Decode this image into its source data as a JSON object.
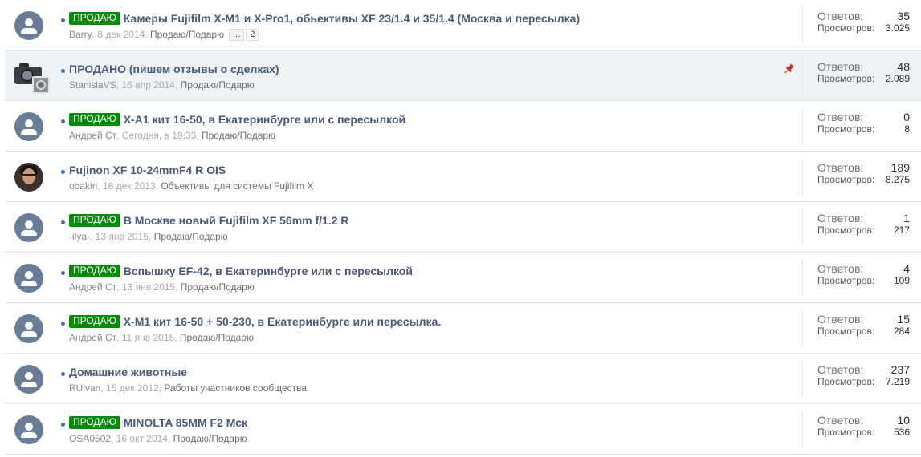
{
  "stats_labels": {
    "replies": "Ответов:",
    "views": "Просмотров:"
  },
  "colors": {
    "prefix_bg": "#0a8a0a",
    "title": "#4a5a7a",
    "avatar_default": "#6a7d96",
    "sticky_row": "#f0f3f6",
    "pin": "#c9302c"
  },
  "threads": [
    {
      "avatar": "default-avatar",
      "prefix": "ПРОДАЮ",
      "title": "Камеры Fujifilm X-M1 и X-Pro1, обьективы XF 23/1.4 и 35/1.4 (Москва и пересылка)",
      "author": "Barry",
      "date": "8 дек 2014",
      "forum": "Продаю/Подарю",
      "pages": [
        "...",
        "2"
      ],
      "replies": "35",
      "views": "3.025"
    },
    {
      "avatar": "camera-avatar",
      "sticky": true,
      "prefix": "",
      "title": "ПРОДАНО (пишем отзывы о сделках)",
      "author": "StanislaVS",
      "date": "16 апр 2014",
      "forum": "Продаю/Подарю",
      "replies": "48",
      "views": "2.089"
    },
    {
      "avatar": "default-avatar",
      "prefix": "ПРОДАЮ",
      "title": "X-A1 кит 16-50, в Екатеринбурге или с пересылкой",
      "author": "Андрей Ст",
      "date": "Сегодня, в 19:33",
      "forum": "Продаю/Подарю",
      "replies": "0",
      "views": "8"
    },
    {
      "avatar": "person-avatar",
      "prefix": "",
      "title": "Fujinon XF 10-24mmF4 R OIS",
      "author": "obakiri",
      "date": "18 дек 2013",
      "forum": "Объективы для системы Fujifilm X",
      "replies": "189",
      "views": "8.275"
    },
    {
      "avatar": "default-avatar",
      "prefix": "ПРОДАЮ",
      "title": "В Москве новый Fujifilm XF 56mm f/1.2 R",
      "author": "-ilya-",
      "date": "13 янв 2015",
      "forum": "Продаю/Подарю",
      "replies": "1",
      "views": "217"
    },
    {
      "avatar": "default-avatar",
      "prefix": "ПРОДАЮ",
      "title": "Вспышку EF-42, в Екатеринбурге или с пересылкой",
      "author": "Андрей Ст",
      "date": "13 янв 2015",
      "forum": "Продаю/Подарю",
      "replies": "4",
      "views": "109"
    },
    {
      "avatar": "default-avatar",
      "prefix": "ПРОДАЮ",
      "title": "X-M1 кит 16-50 + 50-230, в Екатеринбурге или пересылка.",
      "author": "Андрей Ст",
      "date": "11 янв 2015",
      "forum": "Продаю/Подарю",
      "replies": "15",
      "views": "284"
    },
    {
      "avatar": "default-avatar",
      "prefix": "",
      "title": "Домашние животные",
      "author": "RUlvan",
      "date": "15 дек 2012",
      "forum": "Работы участников сообщества",
      "replies": "237",
      "views": "7.219"
    },
    {
      "avatar": "default-avatar",
      "prefix": "ПРОДАЮ",
      "title": "MINOLTA 85MM F2 Мск",
      "author": "OSA0502",
      "date": "16 окт 2014",
      "forum": "Продаю/Подарю",
      "replies": "10",
      "views": "536"
    }
  ]
}
